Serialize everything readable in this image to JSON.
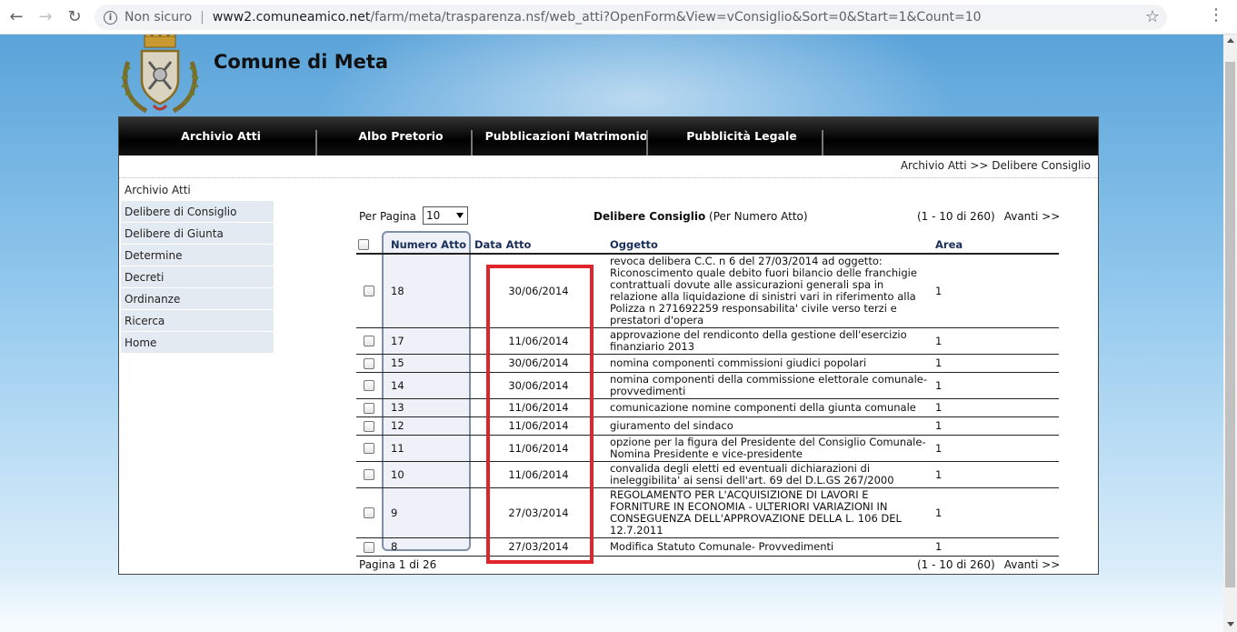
{
  "browser": {
    "security_label": "Non sicuro",
    "url_host": "www2.comuneamico.net",
    "url_path": "/farm/meta/trasparenza.nsf/web_atti?OpenForm&View=vConsiglio&Sort=0&Start=1&Count=10"
  },
  "site": {
    "title": "Comune di Meta"
  },
  "topnav": [
    {
      "label": "Archivio Atti"
    },
    {
      "label": "Albo Pretorio"
    },
    {
      "label": "Pubblicazioni Matrimonio"
    },
    {
      "label": "Pubblicità Legale"
    }
  ],
  "breadcrumb": "Archivio Atti >> Delibere Consiglio",
  "sidebar": {
    "heading": "Archivio Atti",
    "items": [
      {
        "label": "Delibere di Consiglio"
      },
      {
        "label": "Delibere di Giunta"
      },
      {
        "label": "Determine"
      },
      {
        "label": "Decreti"
      },
      {
        "label": "Ordinanze"
      },
      {
        "label": "Ricerca"
      },
      {
        "label": "Home"
      }
    ]
  },
  "listing": {
    "per_page_label": "Per Pagina",
    "per_page_value": "10",
    "view_title_bold": "Delibere Consiglio",
    "view_title_rest": "(Per Numero Atto)",
    "range": "(1 - 10 di 260)",
    "next_label": "Avanti >>",
    "page_info": "Pagina 1 di 26",
    "columns": {
      "numero": "Numero Atto",
      "data": "Data Atto",
      "oggetto": "Oggetto",
      "area": "Area"
    },
    "rows": [
      {
        "numero": "18",
        "data": "30/06/2014",
        "oggetto": "revoca delibera C.C. n 6 del 27/03/2014 ad oggetto: Riconoscimento quale debito fuori bilancio delle franchigie contrattuali dovute alle assicurazioni generali spa in relazione alla liquidazione di sinistri vari in riferimento alla Polizza n 271692259 responsabilita' civile verso terzi e prestatori d'opera",
        "area": "1"
      },
      {
        "numero": "17",
        "data": "11/06/2014",
        "oggetto": "approvazione del rendiconto della gestione dell'esercizio finanziario 2013",
        "area": "1"
      },
      {
        "numero": "15",
        "data": "30/06/2014",
        "oggetto": "nomina componenti commissioni giudici popolari",
        "area": "1"
      },
      {
        "numero": "14",
        "data": "30/06/2014",
        "oggetto": "nomina componenti della commissione elettorale comunale-provvedimenti",
        "area": "1"
      },
      {
        "numero": "13",
        "data": "11/06/2014",
        "oggetto": "comunicazione nomine componenti della giunta comunale",
        "area": "1"
      },
      {
        "numero": "12",
        "data": "11/06/2014",
        "oggetto": "giuramento del sindaco",
        "area": "1"
      },
      {
        "numero": "11",
        "data": "11/06/2014",
        "oggetto": "opzione per la figura del Presidente del Consiglio Comunale-Nomina Presidente e vice-presidente",
        "area": "1"
      },
      {
        "numero": "10",
        "data": "11/06/2014",
        "oggetto": "convalida degli eletti ed eventuali dichiarazioni di ineleggibilita' ai sensi dell'art. 69 del D.L.GS 267/2000",
        "area": "1"
      },
      {
        "numero": "9",
        "data": "27/03/2014",
        "oggetto": "REGOLAMENTO PER L'ACQUISIZIONE DI LAVORI E FORNITURE IN ECONOMIA - ULTERIORI VARIAZIONI IN CONSEGUENZA DELL'APPROVAZIONE DELLA L. 106 DEL 12.7.2011",
        "area": "1"
      },
      {
        "numero": "8",
        "data": "27/03/2014",
        "oggetto": "Modifica Statuto Comunale- Provvedimenti",
        "area": "1"
      }
    ]
  },
  "colors": {
    "highlight": "#e0242c",
    "nav_bg": "#000000",
    "sidebar_bg": "#e4eaf2"
  }
}
